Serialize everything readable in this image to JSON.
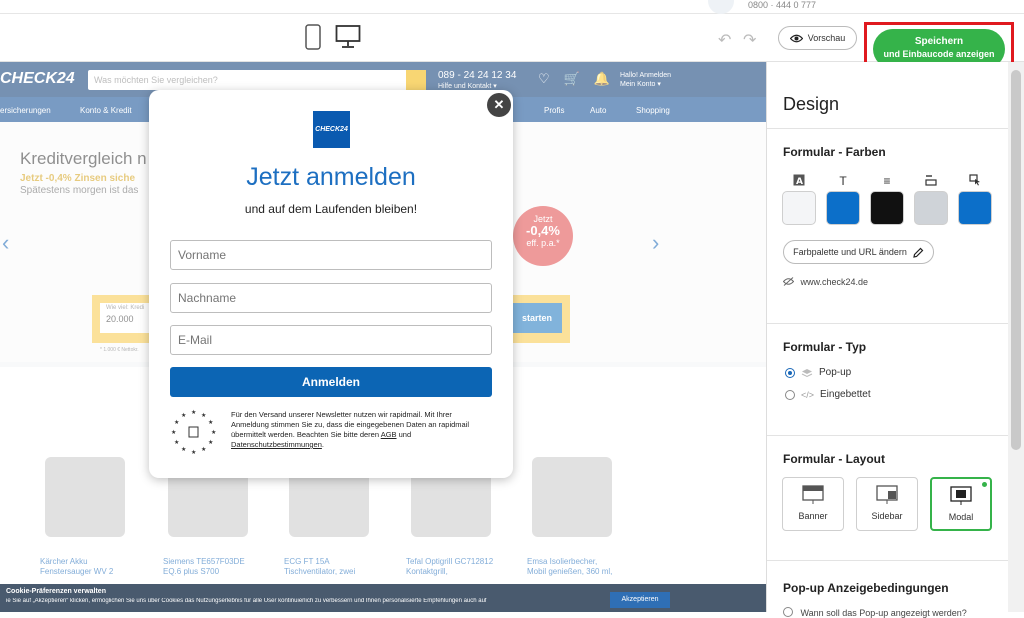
{
  "topbar": {
    "phone": "0800 · 444 0 777"
  },
  "toolbar": {
    "preview_label": "Vorschau",
    "save_label": "Speichern",
    "save_sublabel": "und Einbaucode anzeigen"
  },
  "site": {
    "logo": "CHECK24",
    "search_placeholder": "Was möchten Sie vergleichen?",
    "hotline": "089 - 24 24 12 34",
    "hotline_sub": "Hilfe und Kontakt ▾",
    "login_line1": "Hallo! Anmelden",
    "login_line2": "Mein Konto ▾",
    "nav": [
      "ersicherungen",
      "Konto & Kredit",
      "Profis",
      "Auto",
      "Shopping"
    ],
    "hero_title": "Kreditvergleich n",
    "hero_highlight": "Jetzt -0,4% Zinsen siche",
    "hero_line": "Spätestens morgen ist das",
    "badge_top": "Jetzt",
    "badge_main": "-0,4%",
    "badge_bottom": "eff. p.a.*",
    "calc_label": "Wie viel: Kredi",
    "calc_value": "20.000",
    "calc_button": "starten",
    "calc_note": "* 1.000 € Nettokr.",
    "products": [
      {
        "name1": "Kärcher Akku",
        "name2": "Fenstersauger WV 2"
      },
      {
        "name1": "Siemens TE657F03DE",
        "name2": "EQ.6 plus S700"
      },
      {
        "name1": "ECG FT 15A",
        "name2": "Tischventilator, zwei"
      },
      {
        "name1": "Tefal Optigrill GC712812",
        "name2": "Kontaktgrill,"
      },
      {
        "name1": "Emsa Isolierbecher,",
        "name2": "Mobil genießen, 360 ml,"
      }
    ],
    "cookie_title": "Cookie-Präferenzen verwalten",
    "cookie_text": "ie Sie auf „Akzeptieren“ klicken, ermöglichen Sie uns über Cookies das Nutzungserlebnis für alle User kontinuierlich zu verbessern und Ihnen personalisierte Empfehlungen auch auf",
    "cookie_accept": "Akzeptieren"
  },
  "modal": {
    "logo": "CHECK24",
    "title": "Jetzt anmelden",
    "subtitle": "und auf dem Laufenden bleiben!",
    "first_name_placeholder": "Vorname",
    "last_name_placeholder": "Nachname",
    "email_placeholder": "E-Mail",
    "submit_label": "Anmelden",
    "legal_text": "Für den Versand unserer Newsletter nutzen wir rapidmail. Mit Ihrer Anmeldung stimmen Sie zu, dass die eingegebenen Daten an rapidmail übermittelt werden. Beachten Sie bitte deren",
    "legal_link1": "AGB",
    "legal_and": "und",
    "legal_link2": "Datenschutzbestimmungen",
    "legal_end": "."
  },
  "panel": {
    "title": "Design",
    "colors_heading": "Formular - Farben",
    "swatches": [
      {
        "icon": "text-background-icon",
        "color": "#f4f5f7"
      },
      {
        "icon": "text-color-icon",
        "color": "#0c6fc9"
      },
      {
        "icon": "paragraph-icon",
        "color": "#111111"
      },
      {
        "icon": "button-style-icon",
        "color": "#cfd3d8"
      },
      {
        "icon": "cursor-select-icon",
        "color": "#0c6fc9"
      }
    ],
    "palette_button": "Farbpalette und URL ändern",
    "url": "www.check24.de",
    "type_heading": "Formular - Typ",
    "type_popup": "Pop-up",
    "type_embedded": "Eingebettet",
    "layout_heading": "Formular - Layout",
    "layout_banner": "Banner",
    "layout_sidebar": "Sidebar",
    "layout_modal": "Modal",
    "conditions_heading": "Pop-up Anzeigebedingungen",
    "conditions_question": "Wann soll das Pop-up angezeigt werden?"
  }
}
